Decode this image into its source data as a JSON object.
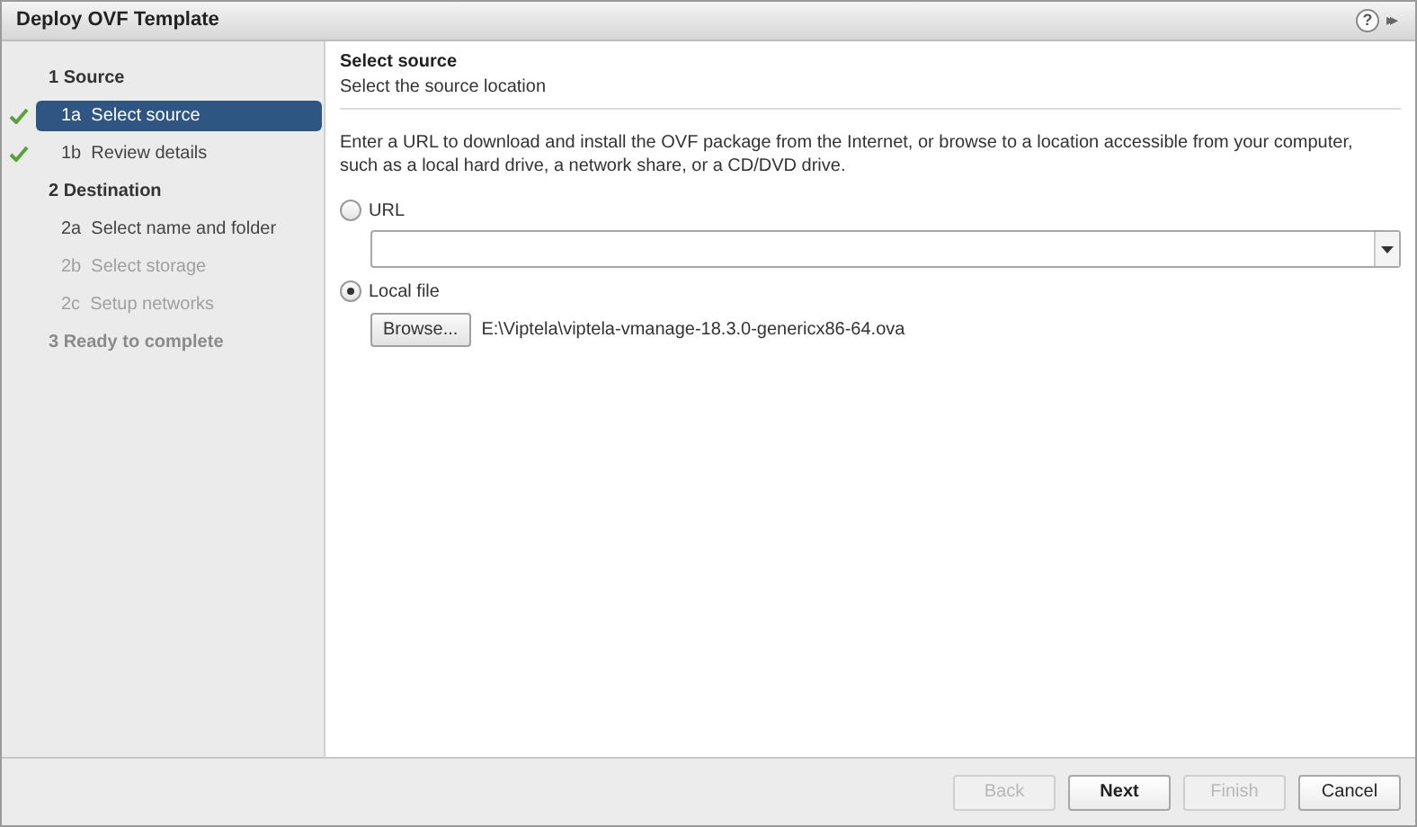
{
  "window": {
    "title": "Deploy OVF Template",
    "help_label": "?",
    "expand_label": "▸▸"
  },
  "steps": [
    {
      "label": "1 Source",
      "disabled": false,
      "children": [
        {
          "label": "1a  Select source",
          "selected": true,
          "done": true,
          "disabled": false
        },
        {
          "label": "1b  Review details",
          "selected": false,
          "done": true,
          "disabled": false
        }
      ]
    },
    {
      "label": "2 Destination",
      "disabled": false,
      "children": [
        {
          "label": "2a  Select name and folder",
          "selected": false,
          "done": false,
          "disabled": false
        },
        {
          "label": "2b  Select storage",
          "selected": false,
          "done": false,
          "disabled": true
        },
        {
          "label": "2c  Setup networks",
          "selected": false,
          "done": false,
          "disabled": true
        }
      ]
    },
    {
      "label": "3 Ready to complete",
      "disabled": true
    }
  ],
  "page": {
    "title": "Select source",
    "subtitle": "Select the source location",
    "description": "Enter a URL to download and install the OVF package from the Internet, or browse to a location accessible from your computer, such as a local hard drive, a network share, or a CD/DVD drive.",
    "options": [
      {
        "label": "URL",
        "selected": false
      },
      {
        "label": "Local file",
        "selected": true
      }
    ],
    "browse_label": "Browse...",
    "file_path": "E:\\Viptela\\viptela-vmanage-18.3.0-genericx86-64.ova"
  },
  "buttons": [
    {
      "label": "Back",
      "disabled": true,
      "primary": false
    },
    {
      "label": "Next",
      "disabled": false,
      "primary": true
    },
    {
      "label": "Finish",
      "disabled": true,
      "primary": false
    },
    {
      "label": "Cancel",
      "disabled": false,
      "primary": false
    }
  ]
}
